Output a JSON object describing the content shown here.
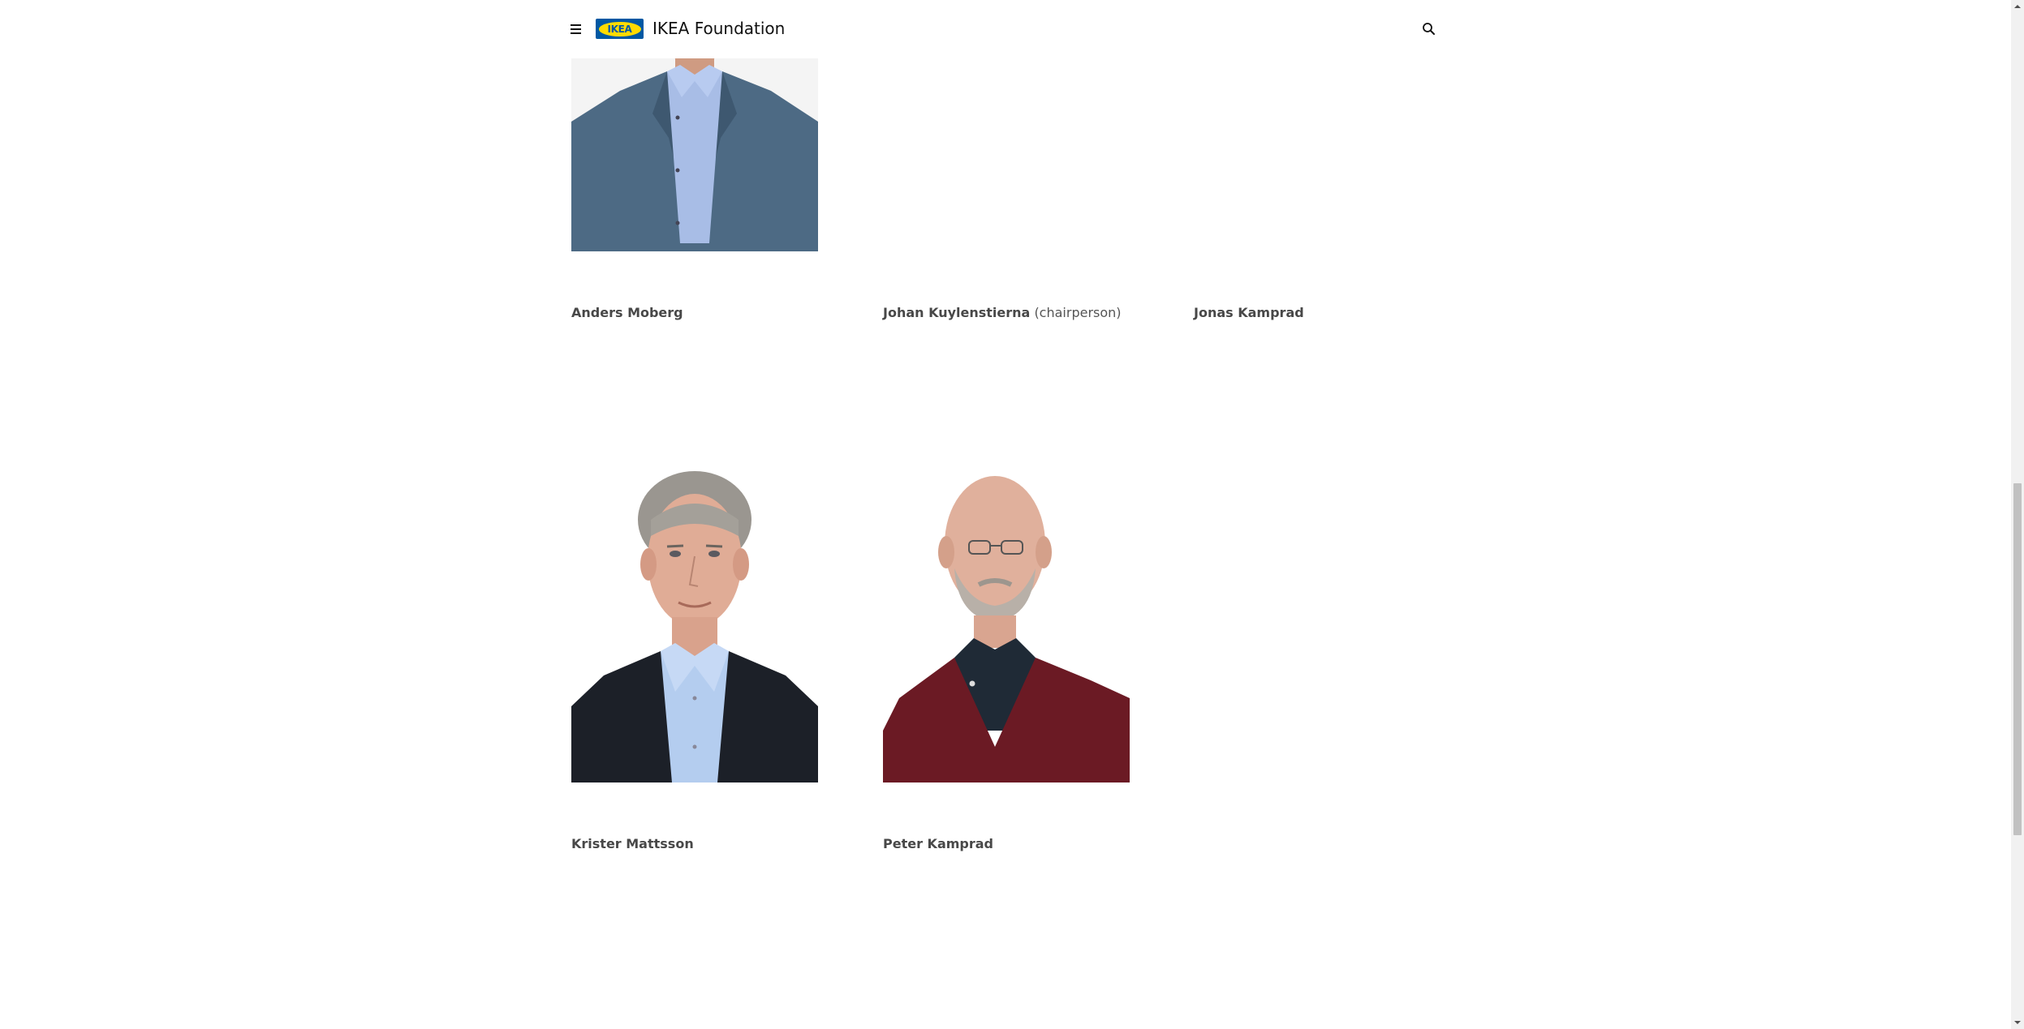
{
  "header": {
    "logo_text": "IKEA",
    "site_title": "IKEA Foundation",
    "menu_icon": "hamburger-menu-icon",
    "search_icon": "search-icon"
  },
  "board": {
    "members": [
      {
        "name": "Anders Moberg",
        "role": ""
      },
      {
        "name": "Johan Kuylenstierna",
        "role": "(chairperson)"
      },
      {
        "name": "Jonas Kamprad",
        "role": ""
      },
      {
        "name": "Krister Mattsson",
        "role": ""
      },
      {
        "name": "Peter Kamprad",
        "role": ""
      }
    ]
  },
  "colors": {
    "ikea_blue": "#0058a3",
    "ikea_yellow": "#ffdb00",
    "text": "#484848"
  }
}
